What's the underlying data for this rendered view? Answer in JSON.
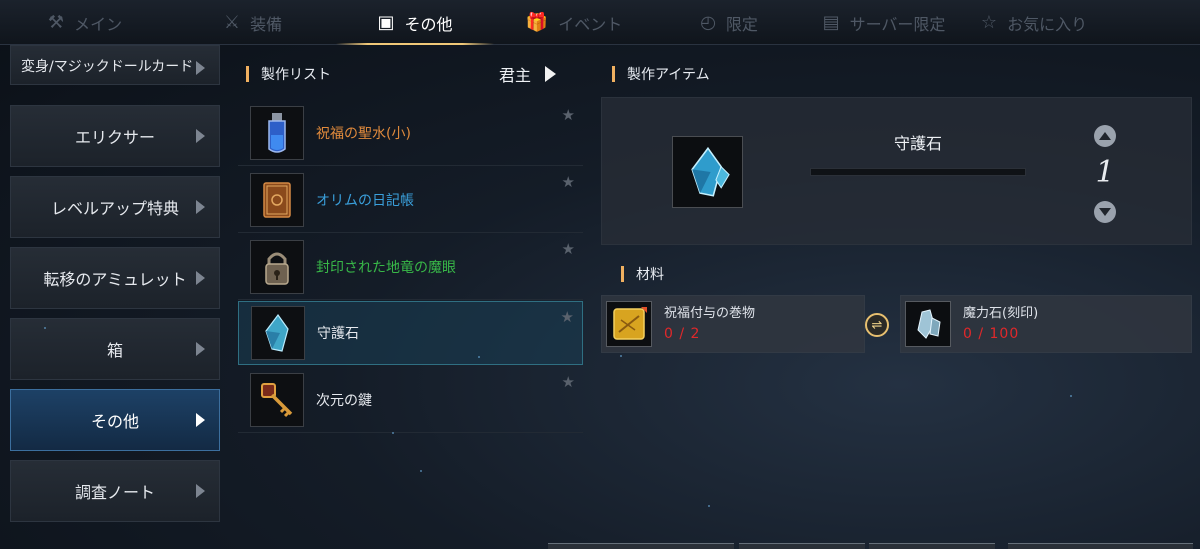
{
  "tabs": [
    {
      "label": "メイン",
      "icon": "anvil-icon",
      "glyph": "⚒",
      "active": false
    },
    {
      "label": "装備",
      "icon": "crossed-swords-icon",
      "glyph": "⚔",
      "active": false
    },
    {
      "label": "その他",
      "icon": "box-icon",
      "glyph": "▣",
      "active": true
    },
    {
      "label": "イベント",
      "icon": "gift-icon",
      "glyph": "🎁",
      "active": false
    },
    {
      "label": "限定",
      "icon": "stopwatch-icon",
      "glyph": "◴",
      "active": false
    },
    {
      "label": "サーバー限定",
      "icon": "server-list-icon",
      "glyph": "▤",
      "active": false
    },
    {
      "label": "お気に入り",
      "icon": "star-outline-icon",
      "glyph": "☆",
      "active": false
    }
  ],
  "categories": [
    {
      "label": "変身/マジックドールカード"
    },
    {
      "label": "エリクサー"
    },
    {
      "label": "レベルアップ特典"
    },
    {
      "label": "転移のアミュレット"
    },
    {
      "label": "箱"
    },
    {
      "label": "その他",
      "active": true
    },
    {
      "label": "調査ノート"
    }
  ],
  "craft_list": {
    "title": "製作リスト",
    "filter_label": "君主",
    "items": [
      {
        "name": "祝福の聖水(小)",
        "color": "#e08a3c",
        "icon": "potion-vial-icon"
      },
      {
        "name": "オリムの日記帳",
        "color": "#3aa0dc",
        "icon": "book-icon"
      },
      {
        "name": "封印された地竜の魔眼",
        "color": "#38b848",
        "icon": "sealed-eye-icon"
      },
      {
        "name": "守護石",
        "color": "#e6e9ee",
        "icon": "crystal-icon",
        "selected": true
      },
      {
        "name": "次元の鍵",
        "color": "#e6e9ee",
        "icon": "key-icon"
      }
    ]
  },
  "craft_item": {
    "title": "製作アイテム",
    "name": "守護石",
    "icon": "crystal-icon",
    "quantity": "1"
  },
  "materials": {
    "title": "材料",
    "items": [
      {
        "name": "祝福付与の巻物",
        "count": "0 / 2",
        "icon": "scroll-icon"
      },
      {
        "name": "魔力石(刻印)",
        "count": "0 / 100",
        "icon": "magic-stone-icon"
      }
    ]
  },
  "colors": {
    "accent": "#f0b060",
    "shortage": "#e0282a",
    "selected_bg": "#1d4166"
  }
}
